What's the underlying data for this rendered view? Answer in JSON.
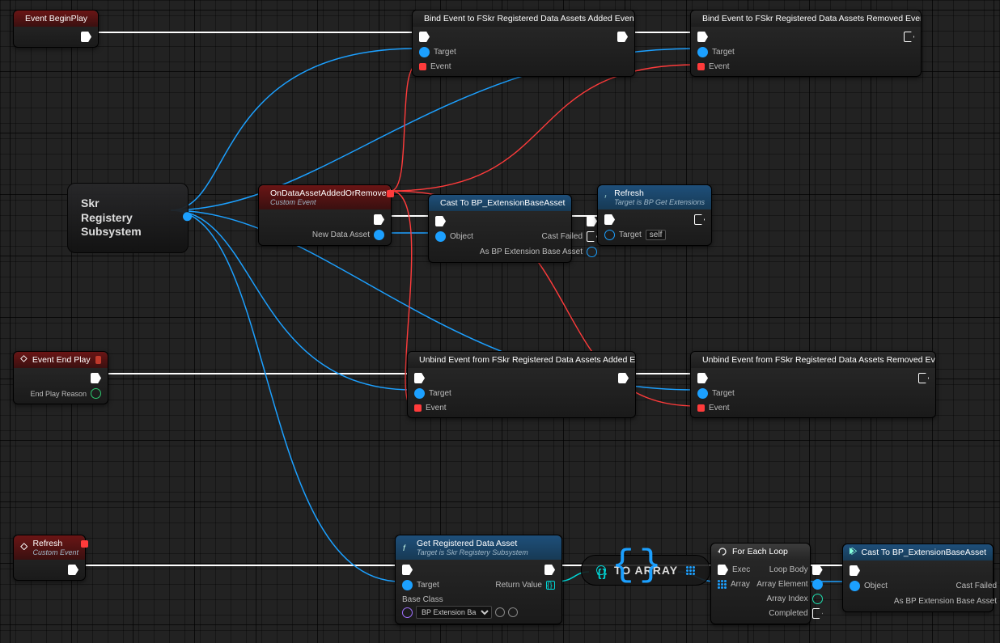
{
  "labels": {
    "target": "Target",
    "event": "Event",
    "object": "Object",
    "castFailed": "Cast Failed",
    "asExt": "As BP Extension Base Asset",
    "returnValue": "Return Value",
    "exec": "Exec"
  },
  "nodes": {
    "beginPlay": {
      "title": "Event BeginPlay"
    },
    "bindAdded": {
      "title": "Bind Event to FSkr Registered Data Assets Added Event"
    },
    "bindRemoved": {
      "title": "Bind Event to FSkr Registered Data Assets Removed Event"
    },
    "subsystem": {
      "line1": "Skr",
      "line2": "Registery",
      "line3": "Subsystem"
    },
    "onDataAsset": {
      "title": "OnDataAssetAddedOrRemoved",
      "subtitle": "Custom Event",
      "outParam": "New Data Asset"
    },
    "castTop": {
      "title": "Cast To BP_ExtensionBaseAsset"
    },
    "refreshCall": {
      "title": "Refresh",
      "subtitle": "Target is BP Get Extensions",
      "targetValue": "self"
    },
    "endPlay": {
      "title": "Event End Play",
      "outParam": "End Play Reason"
    },
    "unbindAdded": {
      "title": "Unbind Event from FSkr Registered Data Assets Added Event"
    },
    "unbindRemoved": {
      "title": "Unbind Event from FSkr Registered Data Assets Removed Event"
    },
    "refreshEvent": {
      "title": "Refresh",
      "subtitle": "Custom Event"
    },
    "getRegistered": {
      "title": "Get Registered Data Asset",
      "subtitle": "Target is Skr Registery Subsystem",
      "baseClassLabel": "Base Class",
      "baseClassValue": "BP Extension Ba"
    },
    "toArray": {
      "title": "TO ARRAY"
    },
    "forEach": {
      "title": "For Each Loop",
      "loopBody": "Loop Body",
      "array": "Array",
      "arrayElement": "Array Element",
      "arrayIndex": "Array Index",
      "completed": "Completed"
    },
    "castBottom": {
      "title": "Cast To BP_ExtensionBaseAsset"
    }
  }
}
